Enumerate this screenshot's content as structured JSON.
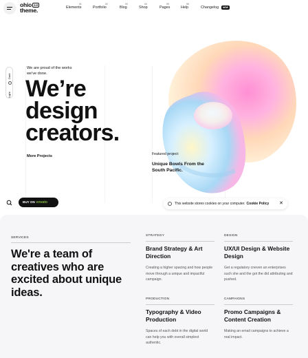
{
  "header": {
    "logo_line1": "ohio",
    "logo_badge": "2.0",
    "logo_line2": "theme.",
    "nav": [
      {
        "num": "01",
        "label": "Elements"
      },
      {
        "num": "02",
        "label": "Portfolio"
      },
      {
        "num": "03",
        "label": "Blog"
      },
      {
        "num": "04",
        "label": "Shop"
      },
      {
        "num": "05",
        "label": "Pages"
      },
      {
        "num": "06",
        "label": "Help"
      },
      {
        "num": "",
        "label": "Changelog"
      }
    ],
    "new_badge": "NEW"
  },
  "theme_switch": {
    "light": "Light",
    "dark": "Dark"
  },
  "hero": {
    "proud": "We are proud of the works we've done.",
    "headline_1": "We’re",
    "headline_2": "design",
    "headline_3": "creators.",
    "more_projects": "More Projects",
    "featured_label": "Featured project:",
    "featured_title": "Unique Bowls From the South Pacific."
  },
  "buy": {
    "prefix": "BUY ON",
    "brand": "envato"
  },
  "cookie": {
    "text": "This website stores cookies on your computer.",
    "policy": "Cookie Policy",
    "close": "✕"
  },
  "services": {
    "label": "SERVICES",
    "title": "We're a team of creatives who are excited about unique ideas.",
    "items": [
      {
        "cat": "STRATEGY",
        "head": "Brand Strategy & Art Direction",
        "desc": "Creating a higher spacing and how people move through a unique and impactful campaign."
      },
      {
        "cat": "DESIGN",
        "head": "UX/UI Design & Website Design",
        "desc": "Get a regulatory cneven an enterprises such she and the got the did attributing and pushed."
      },
      {
        "cat": "PRODUCTION",
        "head": "Typography & Video Production",
        "desc": "Spaces of each debt in the digital world can help you with overall simplest authentic."
      },
      {
        "cat": "CAMPAIGNS",
        "head": "Promo Campaigns & Content Creation",
        "desc": "Making an email campaigns to achieve a real impact."
      }
    ]
  },
  "colors": {
    "accent": "#111111",
    "envato": "#82b440",
    "services_bg": "#f6f6f8"
  }
}
